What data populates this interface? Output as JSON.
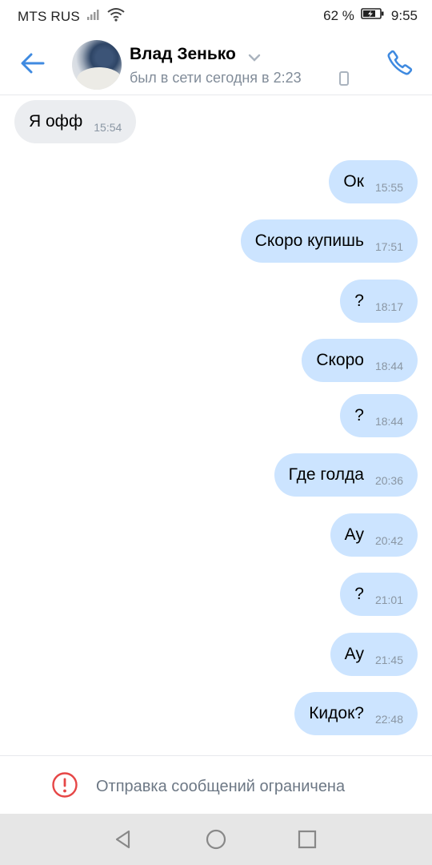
{
  "status_bar": {
    "carrier": "MTS RUS",
    "battery": "62 %",
    "time": "9:55"
  },
  "header": {
    "contact_name": "Влад Зенько",
    "last_seen": "был в сети сегодня в 2:23"
  },
  "messages": [
    {
      "dir": "in",
      "text": "Я офф",
      "time": "15:54"
    },
    {
      "dir": "out",
      "text": "Ок",
      "time": "15:55"
    },
    {
      "dir": "out",
      "text": "Скоро купишь",
      "time": "17:51"
    },
    {
      "dir": "out",
      "text": "?",
      "time": "18:17"
    },
    {
      "dir": "out",
      "text": "Скоро",
      "time": "18:44"
    },
    {
      "dir": "out",
      "text": "?",
      "time": "18:44"
    },
    {
      "dir": "out",
      "text": "Где голда",
      "time": "20:36"
    },
    {
      "dir": "out",
      "text": "Ау",
      "time": "20:42"
    },
    {
      "dir": "out",
      "text": "?",
      "time": "21:01"
    },
    {
      "dir": "out",
      "text": "Ау",
      "time": "21:45"
    },
    {
      "dir": "out",
      "text": "Кидок?",
      "time": "22:48"
    }
  ],
  "footer": {
    "restriction_text": "Отправка сообщений ограничена"
  },
  "colors": {
    "accent": "#3f8ae0",
    "incoming_bubble": "#ebedf0",
    "outgoing_bubble": "#cce4ff",
    "warning": "#e64646"
  }
}
